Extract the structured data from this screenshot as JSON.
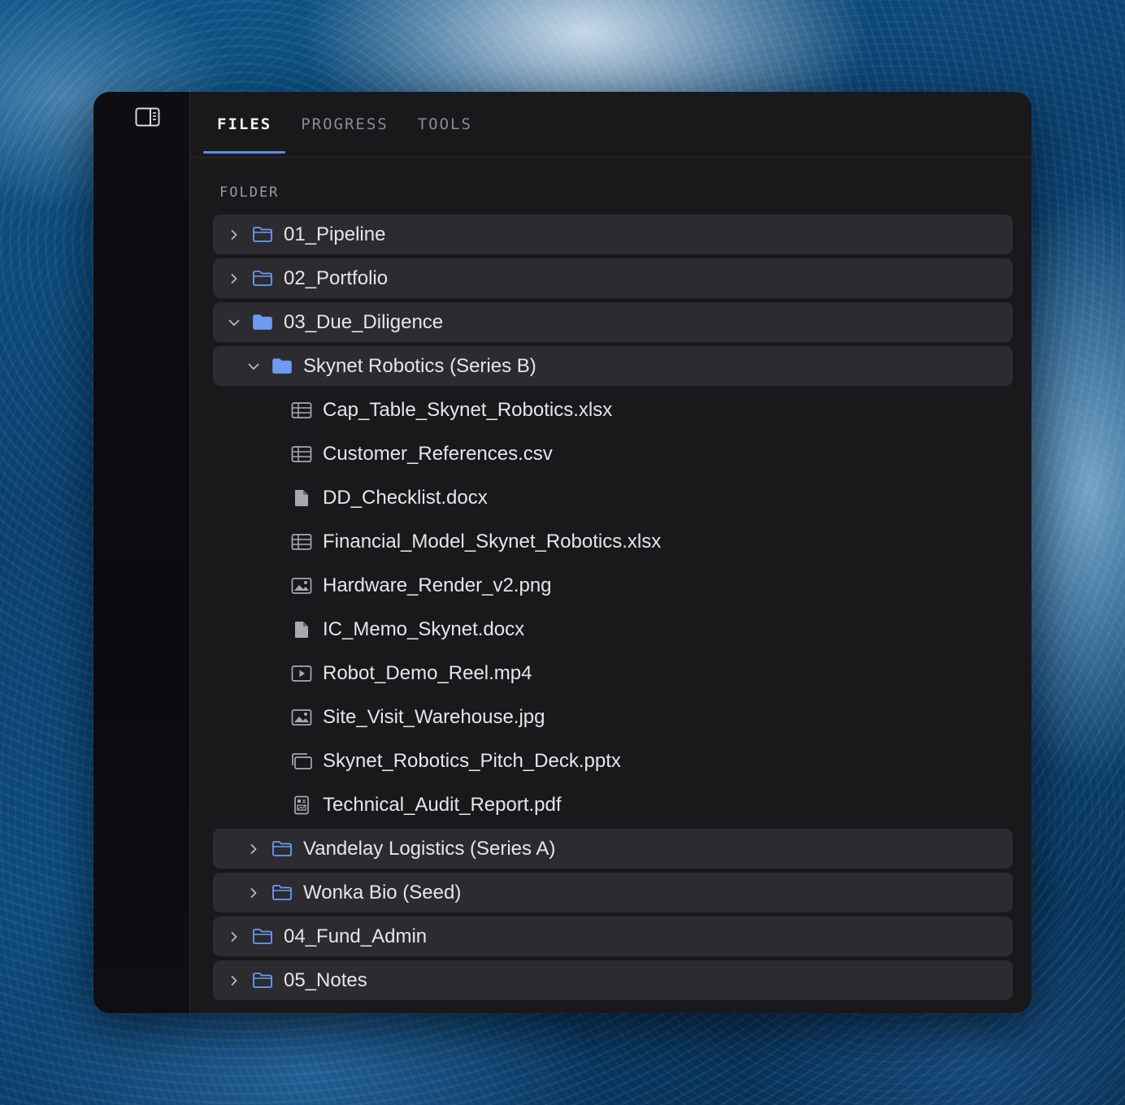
{
  "tabs": [
    {
      "label": "FILES",
      "active": true
    },
    {
      "label": "PROGRESS",
      "active": false
    },
    {
      "label": "TOOLS",
      "active": false
    }
  ],
  "section_label": "FOLDER",
  "colors": {
    "accent": "#5b8de8",
    "folder_fill": "#6b9cf0",
    "row_bg": "#2b2b30",
    "panel_bg": "#19191c"
  },
  "tree": [
    {
      "type": "folder",
      "label": "01_Pipeline",
      "expanded": false,
      "level": 0,
      "icon": "folder-outline-icon"
    },
    {
      "type": "folder",
      "label": "02_Portfolio",
      "expanded": false,
      "level": 0,
      "icon": "folder-outline-icon"
    },
    {
      "type": "folder",
      "label": "03_Due_Diligence",
      "expanded": true,
      "level": 0,
      "icon": "folder-filled-icon"
    },
    {
      "type": "folder",
      "label": "Skynet Robotics (Series B)",
      "expanded": true,
      "level": 1,
      "icon": "folder-filled-icon"
    },
    {
      "type": "file",
      "label": "Cap_Table_Skynet_Robotics.xlsx",
      "level": 2,
      "icon": "spreadsheet-icon"
    },
    {
      "type": "file",
      "label": "Customer_References.csv",
      "level": 2,
      "icon": "spreadsheet-icon"
    },
    {
      "type": "file",
      "label": "DD_Checklist.docx",
      "level": 2,
      "icon": "document-icon"
    },
    {
      "type": "file",
      "label": "Financial_Model_Skynet_Robotics.xlsx",
      "level": 2,
      "icon": "spreadsheet-icon"
    },
    {
      "type": "file",
      "label": "Hardware_Render_v2.png",
      "level": 2,
      "icon": "image-icon"
    },
    {
      "type": "file",
      "label": "IC_Memo_Skynet.docx",
      "level": 2,
      "icon": "document-icon"
    },
    {
      "type": "file",
      "label": "Robot_Demo_Reel.mp4",
      "level": 2,
      "icon": "video-icon"
    },
    {
      "type": "file",
      "label": "Site_Visit_Warehouse.jpg",
      "level": 2,
      "icon": "image-icon"
    },
    {
      "type": "file",
      "label": "Skynet_Robotics_Pitch_Deck.pptx",
      "level": 2,
      "icon": "slides-icon"
    },
    {
      "type": "file",
      "label": "Technical_Audit_Report.pdf",
      "level": 2,
      "icon": "pdf-icon"
    },
    {
      "type": "folder",
      "label": "Vandelay Logistics (Series A)",
      "expanded": false,
      "level": 1,
      "icon": "folder-outline-icon"
    },
    {
      "type": "folder",
      "label": "Wonka Bio (Seed)",
      "expanded": false,
      "level": 1,
      "icon": "folder-outline-icon"
    },
    {
      "type": "folder",
      "label": "04_Fund_Admin",
      "expanded": false,
      "level": 0,
      "icon": "folder-outline-icon"
    },
    {
      "type": "folder",
      "label": "05_Notes",
      "expanded": false,
      "level": 0,
      "icon": "folder-outline-icon"
    }
  ]
}
